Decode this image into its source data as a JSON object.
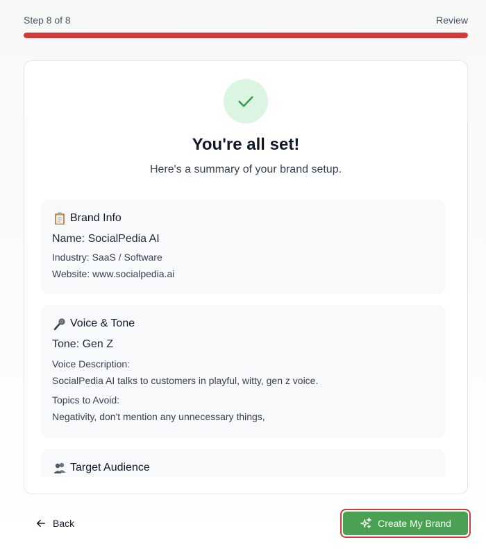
{
  "header": {
    "step_text": "Step 8 of 8",
    "step_name": "Review",
    "progress_fraction": 1.0
  },
  "summary": {
    "title": "You're all set!",
    "subtitle": "Here's a summary of your brand setup.",
    "brand_info": {
      "heading": "Brand Info",
      "icon": "clipboard-icon",
      "name": "Name: SocialPedia AI",
      "industry": "Industry: SaaS / Software",
      "website": "Website: www.socialpedia.ai"
    },
    "voice_tone": {
      "heading": "Voice & Tone",
      "icon": "microphone-icon",
      "tone": "Tone: Gen Z",
      "voice_label": "Voice Description:",
      "voice_text": "SocialPedia AI talks to customers in playful, witty, gen z voice.",
      "avoid_label": "Topics to Avoid:",
      "avoid_text": "Negativity, don't mention any unnecessary things,"
    },
    "target_audience": {
      "heading": "Target Audience",
      "icon": "people-icon"
    }
  },
  "footer": {
    "back_label": "Back",
    "create_label": "Create My Brand"
  },
  "colors": {
    "progress": "#d23a3a",
    "success_bg": "#dcf5e3",
    "success_check": "#3b9a4e",
    "primary_button": "#4aa154",
    "focus_ring": "#cc3b3b"
  }
}
